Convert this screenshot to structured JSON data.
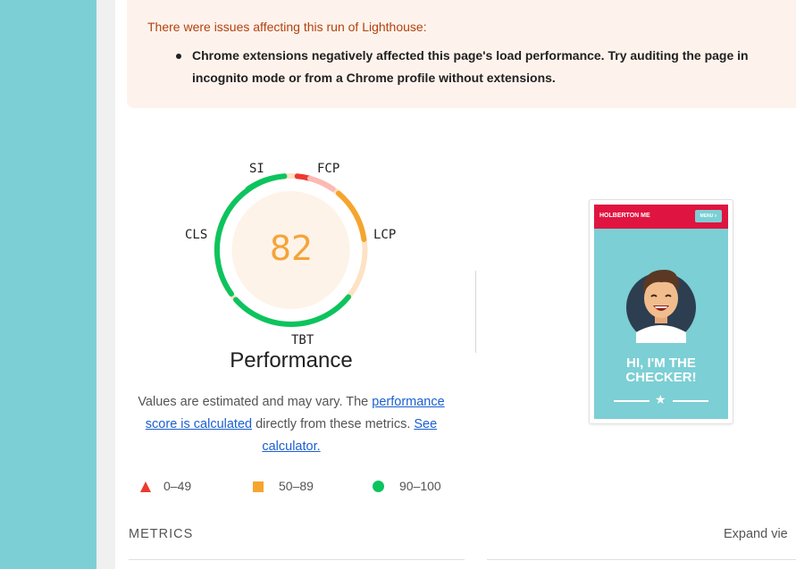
{
  "warning": {
    "title": "There were issues affecting this run of Lighthouse:",
    "items": [
      "Chrome extensions negatively affected this page's load performance. Try auditing the page in incognito mode or from a Chrome profile without extensions."
    ]
  },
  "gauge": {
    "score": "82",
    "title": "Performance",
    "labels": {
      "si": "SI",
      "fcp": "FCP",
      "lcp": "LCP",
      "tbt": "TBT",
      "cls": "CLS"
    },
    "colors": {
      "good": "#0cc45e",
      "average": "#f5a52e",
      "fail": "#eb3a2e",
      "score_text": "#f4a43a"
    }
  },
  "description": {
    "text1": "Values are estimated and may vary. The ",
    "link1": "performance score is calculated",
    "text2": " directly from these metrics. ",
    "link2": "See calculator."
  },
  "legend": {
    "fail": "0–49",
    "average": "50–89",
    "pass": "90–100"
  },
  "screenshot": {
    "brand": "HOLBERTON ME",
    "menu": "MENU ≡",
    "hero": "HI, I'M THE CHECKER!"
  },
  "metrics": {
    "heading": "METRICS",
    "expand": "Expand vie"
  }
}
